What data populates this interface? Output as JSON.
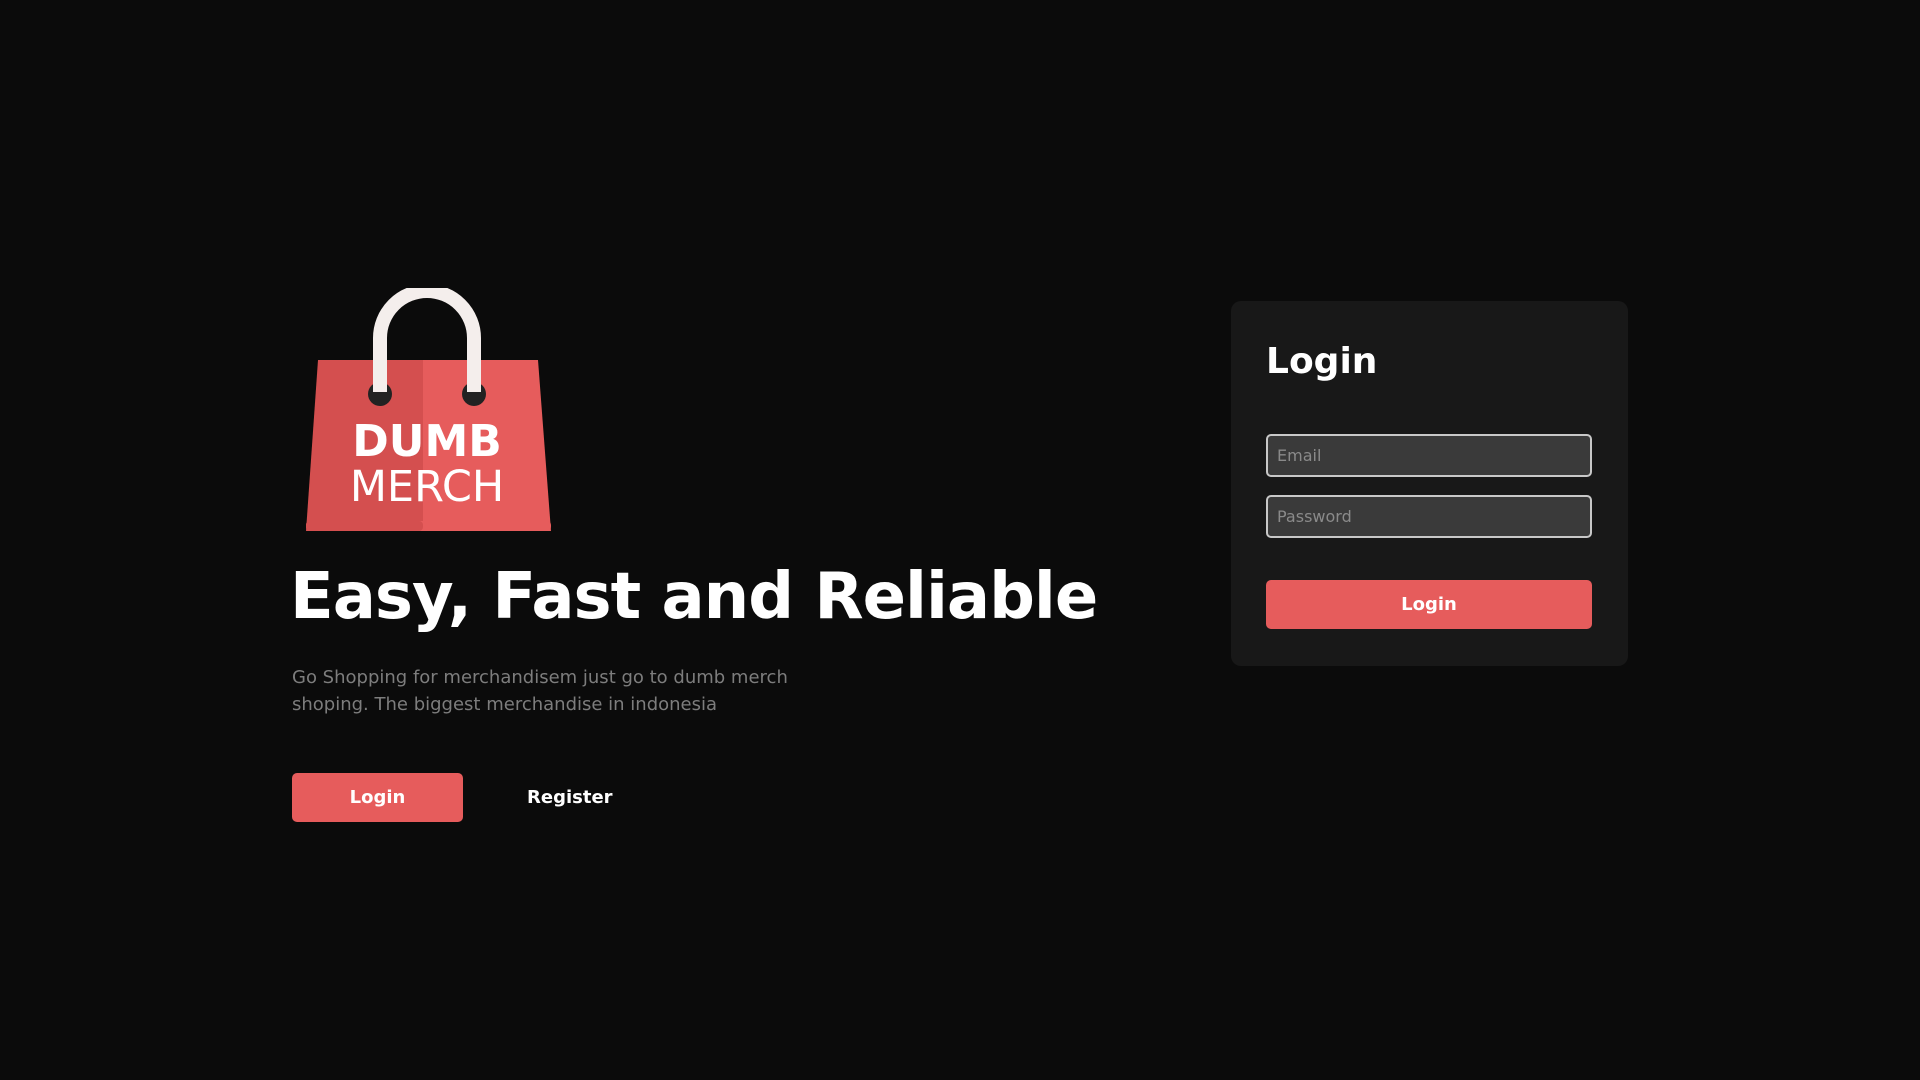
{
  "brand": {
    "logo_line1": "DUMB",
    "logo_line2": "MERCH",
    "accent_color": "#e65c5c",
    "background_color": "#0b0b0b",
    "card_color": "#181818"
  },
  "hero": {
    "headline": "Easy, Fast and Reliable",
    "subtext": "Go Shopping for merchandisem just go to dumb merch shoping. The biggest merchandise in indonesia",
    "login_label": "Login",
    "register_label": "Register"
  },
  "login_form": {
    "title": "Login",
    "email_placeholder": "Email",
    "email_value": "",
    "password_placeholder": "Password",
    "password_value": "",
    "submit_label": "Login"
  }
}
